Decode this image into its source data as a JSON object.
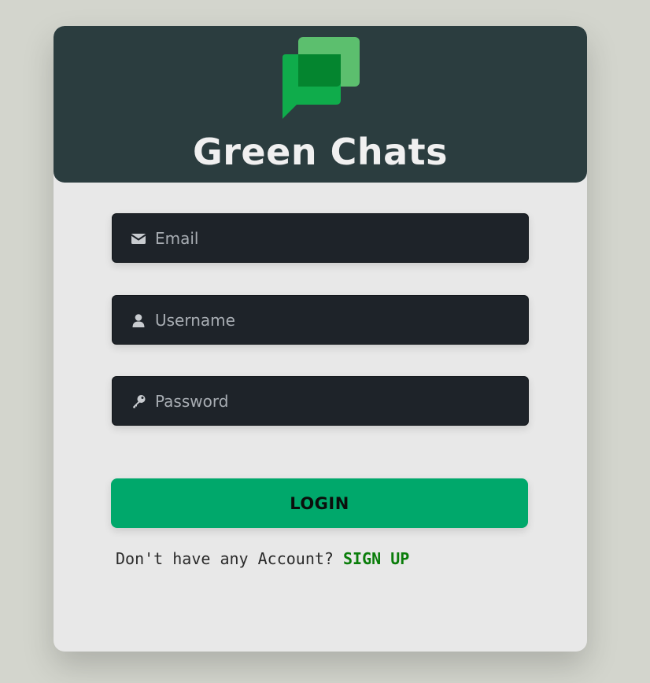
{
  "app": {
    "title": "Green Chats",
    "logo_icon": "chat-bubbles-icon"
  },
  "form": {
    "email": {
      "placeholder": "Email",
      "value": "",
      "icon": "envelope-icon"
    },
    "username": {
      "placeholder": "Username",
      "value": "",
      "icon": "person-icon"
    },
    "password": {
      "placeholder": "Password",
      "value": "",
      "icon": "key-icon"
    }
  },
  "login_button": {
    "label": "LOGIN"
  },
  "signup": {
    "prompt": "Don't have any Account? ",
    "link_label": "SIGN UP"
  },
  "colors": {
    "background": "#d3d5cd",
    "header": "#2b3d3f",
    "card": "#e8e8e8",
    "field": "#1e2329",
    "accent": "#00a86b",
    "link": "#0a7d0a"
  }
}
